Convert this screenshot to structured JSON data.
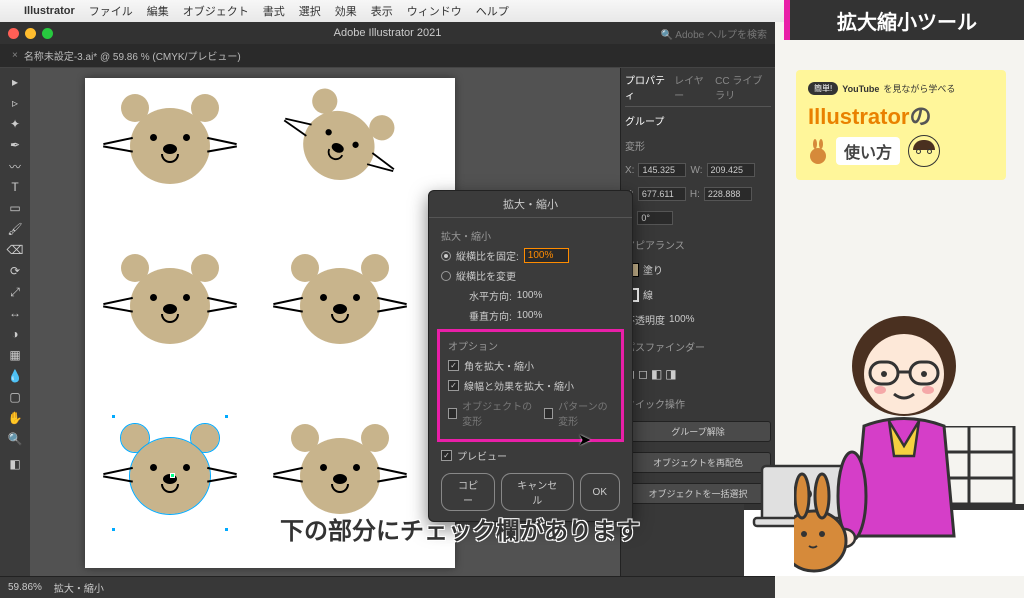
{
  "menubar": {
    "app": "Illustrator",
    "items": [
      "ファイル",
      "編集",
      "オブジェクト",
      "書式",
      "選択",
      "効果",
      "表示",
      "ウィンドウ",
      "ヘルプ"
    ]
  },
  "window": {
    "title": "Adobe Illustrator 2021",
    "search_placeholder": "Adobe ヘルプを検索"
  },
  "tab": {
    "name": "名称未設定-3.ai* @ 59.86 % (CMYK/プレビュー)"
  },
  "panels": {
    "tabs": [
      "プロパティ",
      "レイヤー",
      "CC ライブラリ"
    ],
    "group": "グループ",
    "transform": "変形",
    "x": "145.325",
    "y": "677.611",
    "w": "209.425",
    "h": "228.888",
    "angle": "0°",
    "appearance": "アピアランス",
    "fill": "塗り",
    "stroke": "線",
    "opacity_label": "不透明度",
    "opacity": "100%",
    "pathfinder": "パスファインダー",
    "quick": "クイック操作",
    "b1": "グループ解除",
    "b2": "オブジェクトを再配色",
    "b3": "オブジェクトを一括選択"
  },
  "dialog": {
    "title": "拡大・縮小",
    "section": "拡大・縮小",
    "uniform": "縦横比を固定:",
    "uniform_val": "100%",
    "nonuniform": "縦横比を変更",
    "h_label": "水平方向:",
    "h_val": "100%",
    "v_label": "垂直方向:",
    "v_val": "100%",
    "options": "オプション",
    "opt1": "角を拡大・縮小",
    "opt2": "線幅と効果を拡大・縮小",
    "opt3a": "オブジェクトの変形",
    "opt3b": "パターンの変形",
    "preview": "プレビュー",
    "copy": "コピー",
    "cancel": "キャンセル",
    "ok": "OK"
  },
  "status": {
    "zoom": "59.86%",
    "tool": "拡大・縮小"
  },
  "overlay": {
    "banner": "拡大縮小ツール"
  },
  "ytcard": {
    "badge": "簡単!",
    "line1a": "YouTube",
    "line1b": "を見ながら学べる",
    "brand": "Illustrator",
    "suffix": "の",
    "usage": "使い方"
  },
  "caption": "下の部分にチェック欄があります"
}
